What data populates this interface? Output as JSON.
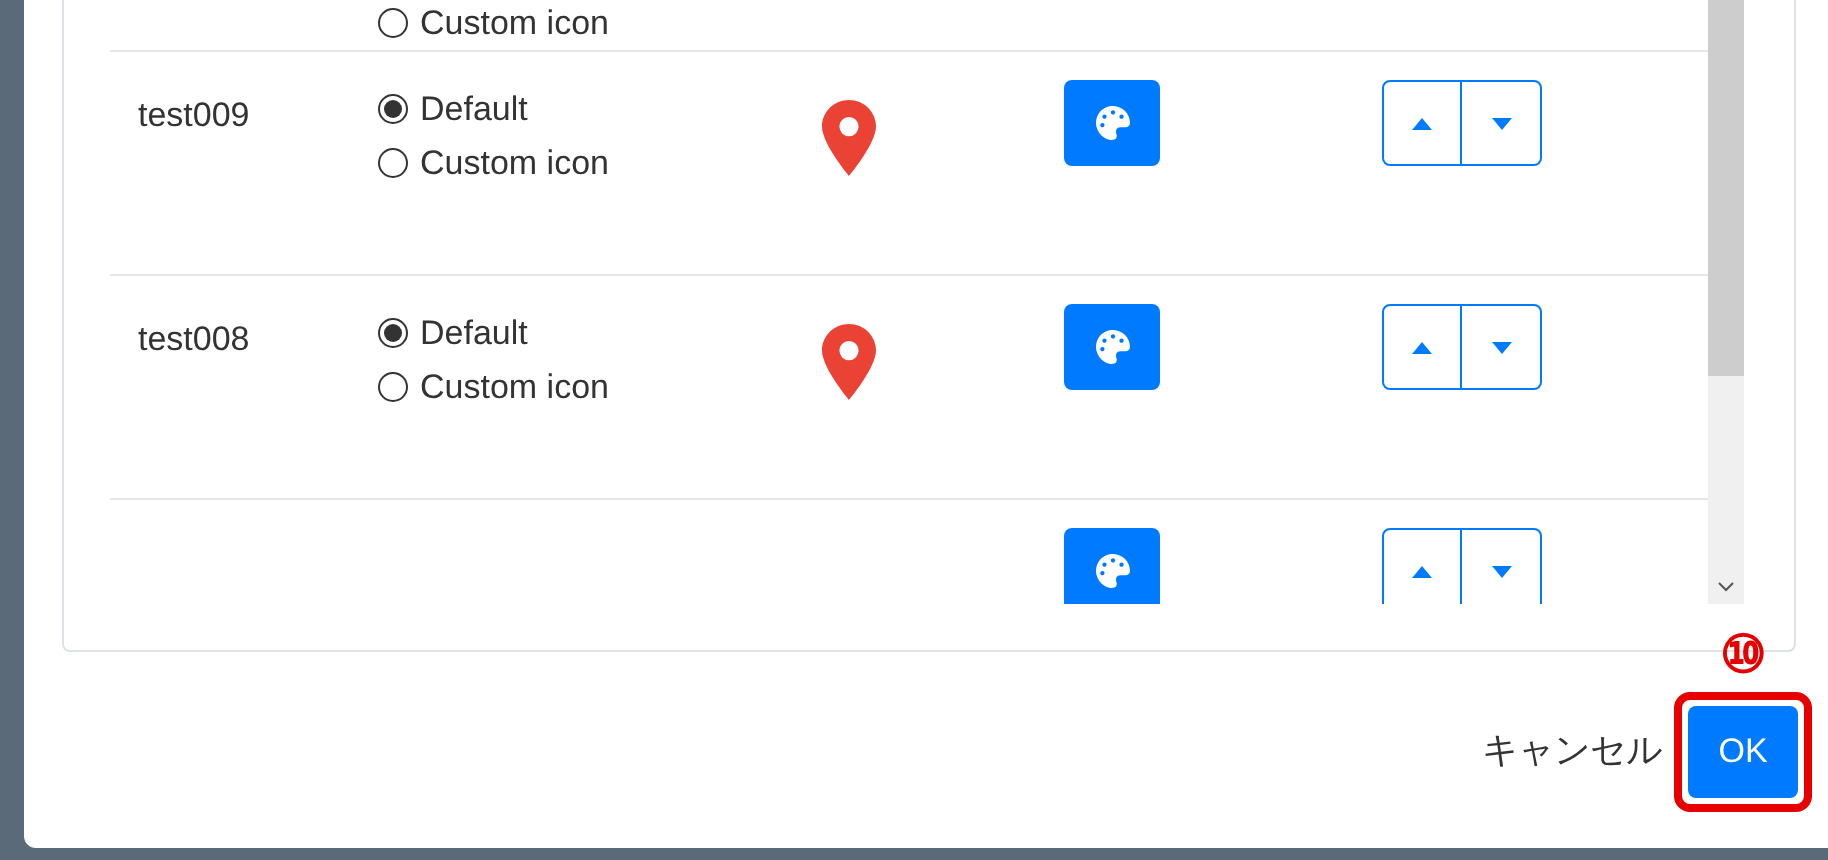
{
  "partial_top_row": {
    "options": [
      {
        "label": "Custom icon",
        "selected": false
      }
    ]
  },
  "rows": [
    {
      "name": "test009",
      "options": [
        {
          "label": "Default",
          "selected": true
        },
        {
          "label": "Custom icon",
          "selected": false
        }
      ]
    },
    {
      "name": "test008",
      "options": [
        {
          "label": "Default",
          "selected": true
        },
        {
          "label": "Custom icon",
          "selected": false
        }
      ]
    }
  ],
  "footer": {
    "cancel": "キャンセル",
    "ok": "OK"
  },
  "annotation": {
    "label": "⑩"
  }
}
